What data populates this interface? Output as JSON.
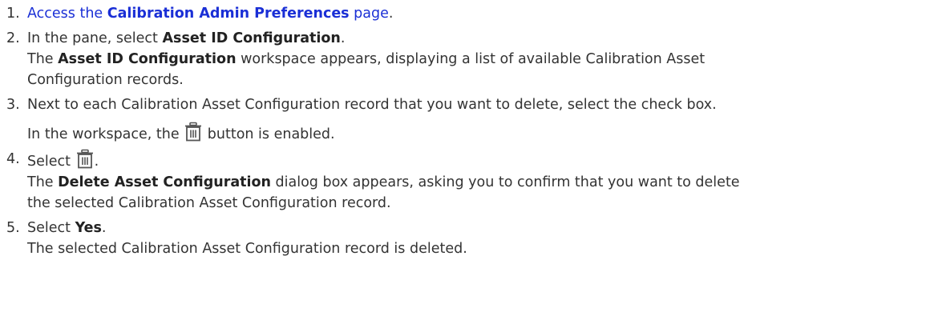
{
  "steps": [
    {
      "num": "1.",
      "link_pre": "Access the ",
      "link_bold": "Calibration Admin Preferences",
      "link_post": " page",
      "end": "."
    },
    {
      "num": "2.",
      "pre": "In the pane, select ",
      "bold": "Asset ID Configuration",
      "post": ".",
      "result_pre": "The ",
      "result_bold": "Asset ID Configuration",
      "result_post": " workspace appears, displaying a list of available Calibration Asset",
      "result_line2": "Configuration records."
    },
    {
      "num": "3.",
      "text": "Next to each Calibration Asset Configuration record that you want to delete, select the check box.",
      "result_pre": "In the workspace, the ",
      "result_icon": "trash-icon",
      "result_post": " button is enabled."
    },
    {
      "num": "4.",
      "pre": "Select ",
      "icon": "trash-icon",
      "post": ".",
      "result_pre": "The ",
      "result_bold": "Delete Asset Configuration",
      "result_post": " dialog box appears, asking you to confirm that you want to delete",
      "result_line2": "the selected Calibration Asset Configuration record."
    },
    {
      "num": "5.",
      "pre": "Select ",
      "bold": "Yes",
      "post": ".",
      "result": "The selected Calibration Asset Configuration record is deleted."
    }
  ],
  "colors": {
    "text": "#333333",
    "link": "#1a2fd6",
    "icon": "#555555"
  }
}
